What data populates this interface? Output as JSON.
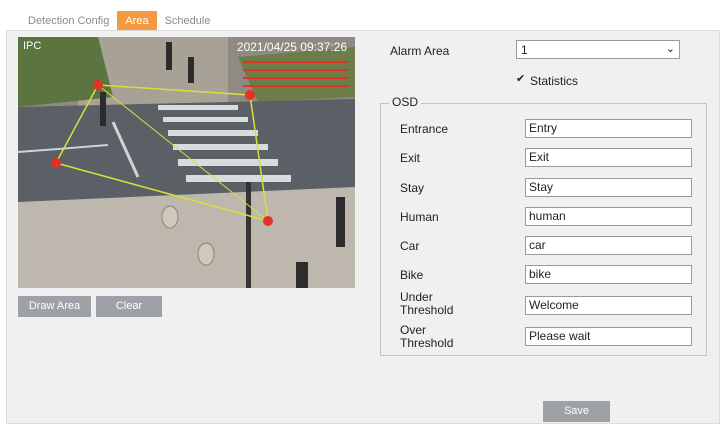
{
  "tabs": [
    {
      "label": "Detection Config",
      "active": false
    },
    {
      "label": "Area",
      "active": true
    },
    {
      "label": "Schedule",
      "active": false
    }
  ],
  "video": {
    "channel": "IPC",
    "timestamp": "2021/04/25 09:37:26"
  },
  "buttons": {
    "draw_area": "Draw Area",
    "clear": "Clear",
    "save": "Save"
  },
  "alarm_area": {
    "label": "Alarm Area",
    "value": "1"
  },
  "statistics": {
    "label": "Statistics",
    "checked": true
  },
  "osd": {
    "title": "OSD",
    "fields": [
      {
        "label": "Entrance",
        "value": "Entry"
      },
      {
        "label": "Exit",
        "value": "Exit"
      },
      {
        "label": "Stay",
        "value": "Stay"
      },
      {
        "label": "Human",
        "value": "human"
      },
      {
        "label": "Car",
        "value": "car"
      },
      {
        "label": "Bike",
        "value": "bike"
      },
      {
        "label": "Under\nThreshold",
        "value": "Welcome"
      },
      {
        "label": "Over\nThreshold",
        "value": "Please wait"
      }
    ]
  },
  "colors": {
    "active_tab": "#f39a43",
    "button": "#9ea1a6",
    "polygon": "#d8df3c",
    "vertex": "#e53024"
  },
  "icons": {
    "dropdown": "chevron-down-icon",
    "checkbox": "checkmark-icon"
  }
}
